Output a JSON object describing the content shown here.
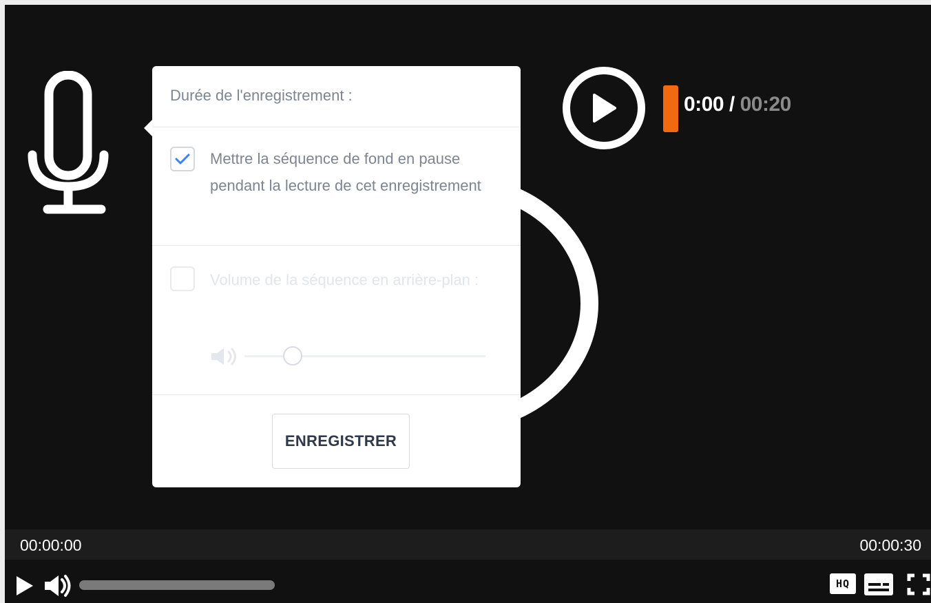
{
  "popup": {
    "title": "Durée de l'enregistrement :",
    "option_pause": {
      "label": "Mettre la séquence de fond en pause pendant la lecture de cet enregistrement",
      "checked": true
    },
    "option_volume": {
      "label": "Volume de la séquence en arrière-plan :",
      "checked": false,
      "volume_level": 0.2
    },
    "save_label": "ENREGISTRER"
  },
  "recorder": {
    "current_time": "0:00",
    "separator": "/",
    "total_time": "00:20"
  },
  "player": {
    "time_start": "00:00:00",
    "time_end": "00:00:30",
    "hq_label": "HQ"
  },
  "colors": {
    "accent": "#f26a10",
    "check": "#3b82f6",
    "background": "#111111"
  },
  "icons": [
    "microphone-icon",
    "play-icon",
    "speaker-icon",
    "hq-icon",
    "subtitles-icon",
    "fullscreen-icon"
  ]
}
